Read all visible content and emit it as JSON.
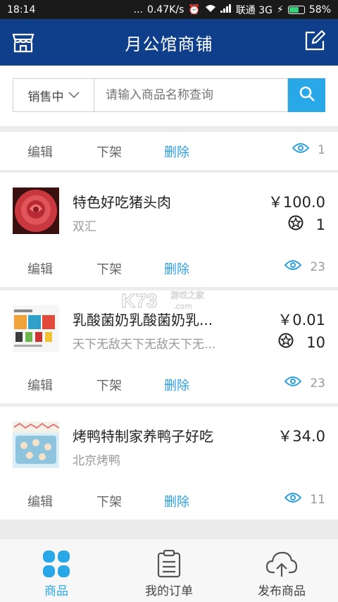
{
  "status_bar": {
    "time": "18:14",
    "dots": "...",
    "speed": "0.47K/s",
    "carrier": "联通 3G",
    "battery": "58%"
  },
  "header": {
    "title": "月公馆商铺",
    "left_icon": "store-icon",
    "right_icon": "edit-icon"
  },
  "search": {
    "filter_label": "销售中",
    "placeholder": "请输入商品名称查询"
  },
  "actions": {
    "edit": "编辑",
    "takedown": "下架",
    "delete": "删除"
  },
  "top_partial": {
    "views": "1"
  },
  "products": [
    {
      "name": "特色好吃猪头肉",
      "desc": "双汇",
      "price": "￥100.0",
      "rating": "1",
      "views": "23"
    },
    {
      "name": "乳酸菌奶乳酸菌奶乳...",
      "desc": "天下无敌天下无敌天下无...",
      "price": "￥0.01",
      "rating": "10",
      "views": "23"
    },
    {
      "name": "烤鸭特制家养鸭子好吃",
      "desc": "北京烤鸭",
      "price": "￥34.0",
      "views": "11"
    }
  ],
  "watermark": {
    "logo": "K73",
    "text": "游戏之家",
    "sub": ".com"
  },
  "bottom_nav": {
    "items": [
      {
        "label": "商品",
        "icon": "grid-icon",
        "active": true
      },
      {
        "label": "我的订单",
        "icon": "clipboard-icon",
        "active": false
      },
      {
        "label": "发布商品",
        "icon": "cloud-upload-icon",
        "active": false
      }
    ]
  },
  "colors": {
    "header_bg": "#0f3f8a",
    "accent": "#2b9ee0",
    "search_button": "#29a8e8"
  }
}
